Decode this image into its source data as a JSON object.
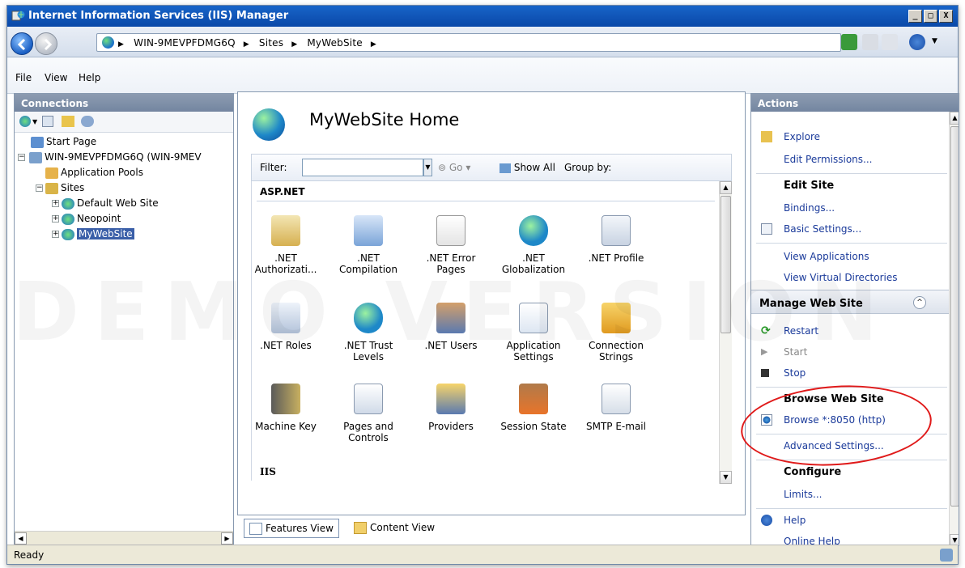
{
  "window": {
    "title": "Internet Information Services (IIS) Manager",
    "min": "_",
    "max": "□",
    "close": "X"
  },
  "address": {
    "crumbs": [
      "WIN-9MEVPFDMG6Q",
      "Sites",
      "MyWebSite"
    ],
    "sep": "▶"
  },
  "menu": {
    "file": "File",
    "view": "View",
    "help": "Help"
  },
  "connections": {
    "header": "Connections",
    "tree": [
      {
        "label": "Start Page"
      },
      {
        "label": "WIN-9MEVPFDMG6Q (WIN-9MEV"
      },
      {
        "label": "Application Pools"
      },
      {
        "label": "Sites"
      },
      {
        "label": "Default Web Site"
      },
      {
        "label": "Neopoint"
      },
      {
        "label": "MyWebSite"
      }
    ]
  },
  "center": {
    "title": "MyWebSite Home",
    "filter_label": "Filter:",
    "go_label": "Go",
    "showall_label": "Show All",
    "groupby_label": "Group by:",
    "groups": {
      "aspnet": "ASP.NET",
      "iis": "IIS"
    },
    "features": [
      {
        "label": ".NET Authorizati..."
      },
      {
        "label": ".NET Compilation"
      },
      {
        "label": ".NET Error Pages"
      },
      {
        "label": ".NET Globalization"
      },
      {
        "label": ".NET Profile"
      },
      {
        "label": ".NET Roles"
      },
      {
        "label": ".NET Trust Levels"
      },
      {
        "label": ".NET Users"
      },
      {
        "label": "Application Settings"
      },
      {
        "label": "Connection Strings"
      },
      {
        "label": "Machine Key"
      },
      {
        "label": "Pages and Controls"
      },
      {
        "label": "Providers"
      },
      {
        "label": "Session State"
      },
      {
        "label": "SMTP E-mail"
      }
    ],
    "tabs": {
      "features": "Features View",
      "content": "Content View"
    }
  },
  "actions": {
    "header": "Actions",
    "explore": "Explore",
    "edit_permissions": "Edit Permissions...",
    "edit_site": "Edit Site",
    "bindings": "Bindings...",
    "basic_settings": "Basic Settings...",
    "view_applications": "View Applications",
    "view_vdirs": "View Virtual Directories",
    "manage_site": "Manage Web Site",
    "restart": "Restart",
    "start": "Start",
    "stop": "Stop",
    "browse_site": "Browse Web Site",
    "browse": "Browse *:8050 (http)",
    "advanced": "Advanced Settings...",
    "configure": "Configure",
    "limits": "Limits...",
    "help": "Help",
    "online_help": "Online Help"
  },
  "status": "Ready",
  "watermark": "DEMO VERSION"
}
